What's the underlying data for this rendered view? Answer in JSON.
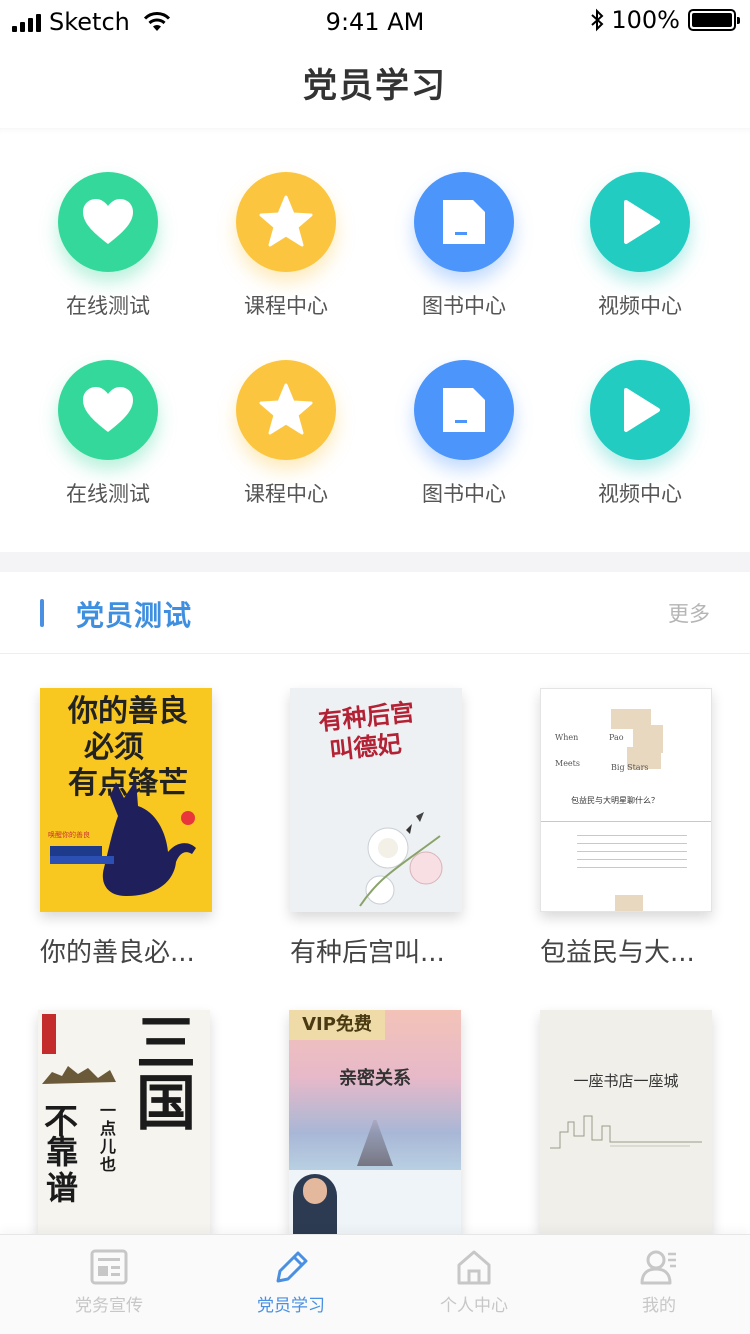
{
  "status_bar": {
    "carrier": "Sketch",
    "time": "9:41 AM",
    "battery": "100%"
  },
  "header": {
    "title": "党员学习"
  },
  "menu": {
    "items": [
      {
        "label": "在线测试",
        "icon": "heart-icon",
        "color": "#35d89b"
      },
      {
        "label": "课程中心",
        "icon": "star-icon",
        "color": "#fbc53f"
      },
      {
        "label": "图书中心",
        "icon": "document-icon",
        "color": "#4c95fb"
      },
      {
        "label": "视频中心",
        "icon": "play-icon",
        "color": "#23ccc1"
      },
      {
        "label": "在线测试",
        "icon": "heart-icon",
        "color": "#35d89b"
      },
      {
        "label": "课程中心",
        "icon": "star-icon",
        "color": "#fbc53f"
      },
      {
        "label": "图书中心",
        "icon": "document-icon",
        "color": "#4c95fb"
      },
      {
        "label": "视频中心",
        "icon": "play-icon",
        "color": "#23ccc1"
      }
    ]
  },
  "section": {
    "title": "党员测试",
    "more": "更多"
  },
  "books": [
    {
      "title": "你的善良必...",
      "cover_text": [
        "你的善良",
        "必须",
        "有点锋芒"
      ],
      "badge": "畅销版",
      "blurb": "初中亿万人",
      "subtitle": "唤醒你的善良"
    },
    {
      "title": "有种后宫叫...",
      "cover_text": [
        "有种后宫",
        "叫德妃"
      ]
    },
    {
      "title": "包益民与大...",
      "cover_words": [
        "When",
        "Pao",
        "Meets",
        "Big Stars"
      ],
      "cover_question": "包益民与大明星聊什么？"
    },
    {
      "title": "",
      "cover_text": [
        "三国",
        "不",
        "靠谱",
        "一点儿也"
      ]
    },
    {
      "title": "",
      "vip": "VIP免费",
      "cover_text": "亲密关系"
    },
    {
      "title": "",
      "cover_text": "一座书店一座城"
    }
  ],
  "tabbar": {
    "tabs": [
      {
        "label": "党务宣传",
        "active": false
      },
      {
        "label": "党员学习",
        "active": true
      },
      {
        "label": "个人中心",
        "active": false
      },
      {
        "label": "我的",
        "active": false
      }
    ]
  },
  "colors": {
    "accent": "#4a90e2",
    "inactive": "#c7c7c7"
  }
}
